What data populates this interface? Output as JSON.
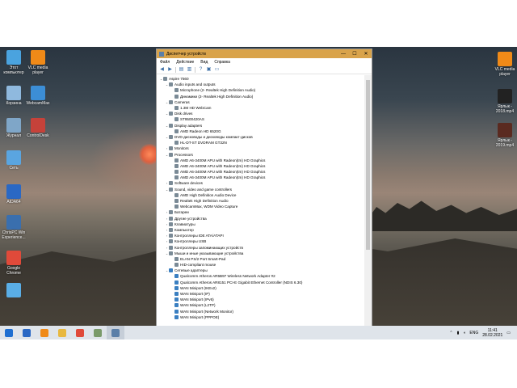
{
  "desktop": {
    "left_icons": [
      {
        "label": "Этот компьютер",
        "icon": "computer-icon",
        "color": "#4aa3df"
      },
      {
        "label": "VLC media player",
        "icon": "vlc-cone-icon",
        "color": "#f08a18"
      },
      {
        "label": "Корзина",
        "icon": "recycle-bin-icon",
        "color": "#8fb9de"
      },
      {
        "label": "WebcamMax",
        "icon": "webcam-icon",
        "color": "#3c8ed6"
      },
      {
        "label": "Журнал",
        "icon": "journal-icon",
        "color": "#7fa6c8"
      },
      {
        "label": "ControlDesk",
        "icon": "control-desk-icon",
        "color": "#c6423a"
      },
      {
        "label": "Сеть",
        "icon": "network-icon",
        "color": "#5aa5e0"
      },
      {
        "label": "AIDA64",
        "icon": "aida64-icon",
        "color": "#2a68c4"
      },
      {
        "label": "ChrisPC Win Experience...",
        "icon": "chrispc-icon",
        "color": "#3a6fae"
      },
      {
        "label": "Google Chrome",
        "icon": "chrome-icon",
        "color": "#e04a3a"
      },
      {
        "label": "",
        "icon": "app-icon",
        "color": "#5aaee6"
      }
    ],
    "right_icons": [
      {
        "label": "VLC media player",
        "icon": "vlc-cone-icon",
        "color": "#f08a18"
      },
      {
        "label": "Ярлык - 2018.mp4",
        "icon": "video-file-icon",
        "color": "#222222"
      },
      {
        "label": "Ярлык - 2019.mp4",
        "icon": "video-file-icon",
        "color": "#5a2a20"
      }
    ]
  },
  "window": {
    "title": "Диспетчер устройств",
    "menu": [
      "Файл",
      "Действие",
      "Вид",
      "Справка"
    ],
    "controls": {
      "minimize": "—",
      "maximize": "☐",
      "close": "✕"
    },
    "tree": [
      {
        "depth": 0,
        "expander": "v",
        "text": "Aspire 7560",
        "kind": "dev"
      },
      {
        "depth": 1,
        "expander": "v",
        "text": "Audio inputs and outputs",
        "kind": "dev"
      },
      {
        "depth": 2,
        "expander": "",
        "text": "Microphone (2- Realtek High Definition Audio)",
        "kind": "dev"
      },
      {
        "depth": 2,
        "expander": "",
        "text": "Динамики (2- Realtek High Definition Audio)",
        "kind": "dev"
      },
      {
        "depth": 1,
        "expander": "v",
        "text": "Cameras",
        "kind": "dev"
      },
      {
        "depth": 2,
        "expander": "",
        "text": "1.3M HD WebCam",
        "kind": "dev"
      },
      {
        "depth": 1,
        "expander": "v",
        "text": "Disk drives",
        "kind": "dev"
      },
      {
        "depth": 2,
        "expander": "",
        "text": "ST9500420AS",
        "kind": "dev"
      },
      {
        "depth": 1,
        "expander": "v",
        "text": "Display adapters",
        "kind": "dev"
      },
      {
        "depth": 2,
        "expander": "",
        "text": "AMD Radeon HD 6520G",
        "kind": "dev"
      },
      {
        "depth": 1,
        "expander": "v",
        "text": "DVD-дисководы и дисководы компакт-дисков",
        "kind": "dev"
      },
      {
        "depth": 2,
        "expander": "",
        "text": "HL-DT-ST DVDRAM GT32N",
        "kind": "dev"
      },
      {
        "depth": 1,
        "expander": ">",
        "text": "Monitors",
        "kind": "dev"
      },
      {
        "depth": 1,
        "expander": "v",
        "text": "Processors",
        "kind": "dev"
      },
      {
        "depth": 2,
        "expander": "",
        "text": "AMD A6-3400M APU with Radeon(tm) HD Graphics",
        "kind": "dev"
      },
      {
        "depth": 2,
        "expander": "",
        "text": "AMD A6-3400M APU with Radeon(tm) HD Graphics",
        "kind": "dev"
      },
      {
        "depth": 2,
        "expander": "",
        "text": "AMD A6-3400M APU with Radeon(tm) HD Graphics",
        "kind": "dev"
      },
      {
        "depth": 2,
        "expander": "",
        "text": "AMD A6-3400M APU with Radeon(tm) HD Graphics",
        "kind": "dev"
      },
      {
        "depth": 1,
        "expander": ">",
        "text": "Software devices",
        "kind": "dev"
      },
      {
        "depth": 1,
        "expander": "v",
        "text": "Sound, video and game controllers",
        "kind": "dev"
      },
      {
        "depth": 2,
        "expander": "",
        "text": "AMD High Definition Audio Device",
        "kind": "dev"
      },
      {
        "depth": 2,
        "expander": "",
        "text": "Realtek High Definition Audio",
        "kind": "dev"
      },
      {
        "depth": 2,
        "expander": "",
        "text": "WebcamMax, WDM Video Capture",
        "kind": "dev"
      },
      {
        "depth": 1,
        "expander": ">",
        "text": "Батареи",
        "kind": "dev"
      },
      {
        "depth": 1,
        "expander": ">",
        "text": "Другие устройства",
        "kind": "dev"
      },
      {
        "depth": 1,
        "expander": ">",
        "text": "Клавиатуры",
        "kind": "dev"
      },
      {
        "depth": 1,
        "expander": ">",
        "text": "Компьютер",
        "kind": "dev"
      },
      {
        "depth": 1,
        "expander": ">",
        "text": "Контроллеры IDE ATA/ATAPI",
        "kind": "dev"
      },
      {
        "depth": 1,
        "expander": ">",
        "text": "Контроллеры USB",
        "kind": "dev"
      },
      {
        "depth": 1,
        "expander": ">",
        "text": "Контроллеры запоминающих устройств",
        "kind": "dev"
      },
      {
        "depth": 1,
        "expander": "v",
        "text": "Мыши и иные указывающие устройства",
        "kind": "dev"
      },
      {
        "depth": 2,
        "expander": "",
        "text": "ELAN PS/2 Port Smart-Pad",
        "kind": "dev"
      },
      {
        "depth": 2,
        "expander": "",
        "text": "HID-compliant mouse",
        "kind": "dev"
      },
      {
        "depth": 1,
        "expander": "v",
        "text": "Сетевые адаптеры",
        "kind": "net"
      },
      {
        "depth": 2,
        "expander": "",
        "text": "Qualcomm Atheros AR5B97 Wireless Network Adapter #2",
        "kind": "net"
      },
      {
        "depth": 2,
        "expander": "",
        "text": "Qualcomm Atheros AR8151 PCI-E Gigabit Ethernet Controller (NDIS 6.30)",
        "kind": "net"
      },
      {
        "depth": 2,
        "expander": "",
        "text": "WAN Miniport (IKEv2)",
        "kind": "net"
      },
      {
        "depth": 2,
        "expander": "",
        "text": "WAN Miniport (IP)",
        "kind": "net"
      },
      {
        "depth": 2,
        "expander": "",
        "text": "WAN Miniport (IPv6)",
        "kind": "net"
      },
      {
        "depth": 2,
        "expander": "",
        "text": "WAN Miniport (L2TP)",
        "kind": "net"
      },
      {
        "depth": 2,
        "expander": "",
        "text": "WAN Miniport (Network Monitor)",
        "kind": "net"
      },
      {
        "depth": 2,
        "expander": "",
        "text": "WAN Miniport (PPPOE)",
        "kind": "net"
      }
    ]
  },
  "taskbar": {
    "items": [
      {
        "icon": "windows-start-icon",
        "color": "#1f6fd1",
        "active": false
      },
      {
        "icon": "aida64-icon",
        "color": "#2a68c4",
        "active": false
      },
      {
        "icon": "vlc-cone-icon",
        "color": "#f08a18",
        "active": false
      },
      {
        "icon": "file-explorer-icon",
        "color": "#e8b840",
        "active": false
      },
      {
        "icon": "chrome-icon",
        "color": "#e04a3a",
        "active": false
      },
      {
        "icon": "tool-icon",
        "color": "#7a9a6a",
        "active": false
      },
      {
        "icon": "device-manager-icon",
        "color": "#5b7fa8",
        "active": true
      }
    ],
    "tray": {
      "language": "ENG",
      "time": "11:41",
      "date": "28.02.2021"
    }
  }
}
